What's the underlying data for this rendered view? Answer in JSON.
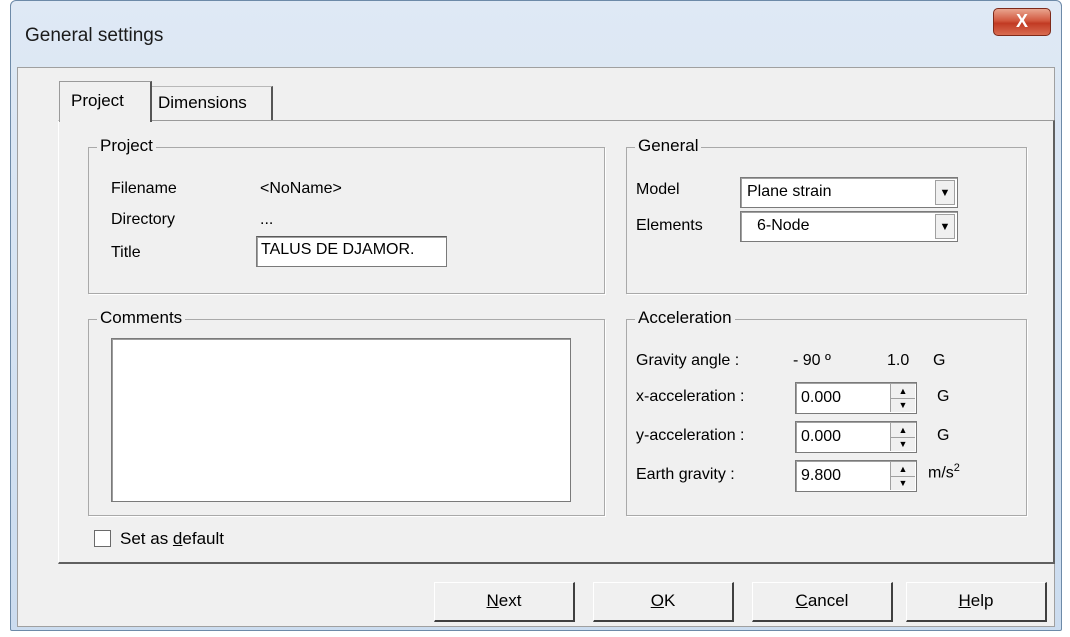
{
  "window": {
    "title": "General settings",
    "close_label": "X"
  },
  "tabs": [
    {
      "label": "Project",
      "active": true
    },
    {
      "label": "Dimensions",
      "active": false
    }
  ],
  "project_group": {
    "legend": "Project",
    "filename_label": "Filename",
    "filename_value": "<NoName>",
    "directory_label": "Directory",
    "directory_value": "...",
    "title_label": "Title",
    "title_value": "TALUS DE DJAMOR."
  },
  "general_group": {
    "legend": "General",
    "model_label": "Model",
    "model_value": "Plane strain",
    "elements_label": "Elements",
    "elements_value": "6-Node"
  },
  "comments_group": {
    "legend": "Comments",
    "value": ""
  },
  "acceleration_group": {
    "legend": "Acceleration",
    "gravity_angle_label": "Gravity angle :",
    "gravity_angle_value": "- 90 º",
    "gravity_magnitude": "1.0",
    "gravity_unit": "G",
    "x_label": "x-acceleration :",
    "x_value": "0.000",
    "x_unit": "G",
    "y_label": "y-acceleration :",
    "y_value": "0.000",
    "y_unit": "G",
    "earth_label": "Earth gravity :",
    "earth_value": "9.800",
    "earth_unit": "m/s",
    "earth_unit_sup": "2"
  },
  "default_checkbox": {
    "label_pre": "Set as ",
    "label_u": "d",
    "label_post": "efault",
    "checked": false
  },
  "buttons": {
    "next": {
      "u": "N",
      "rest": "ext"
    },
    "ok": {
      "u": "O",
      "rest": "K"
    },
    "cancel": {
      "u": "C",
      "rest": "ancel"
    },
    "help": {
      "u": "H",
      "rest": "elp"
    }
  }
}
